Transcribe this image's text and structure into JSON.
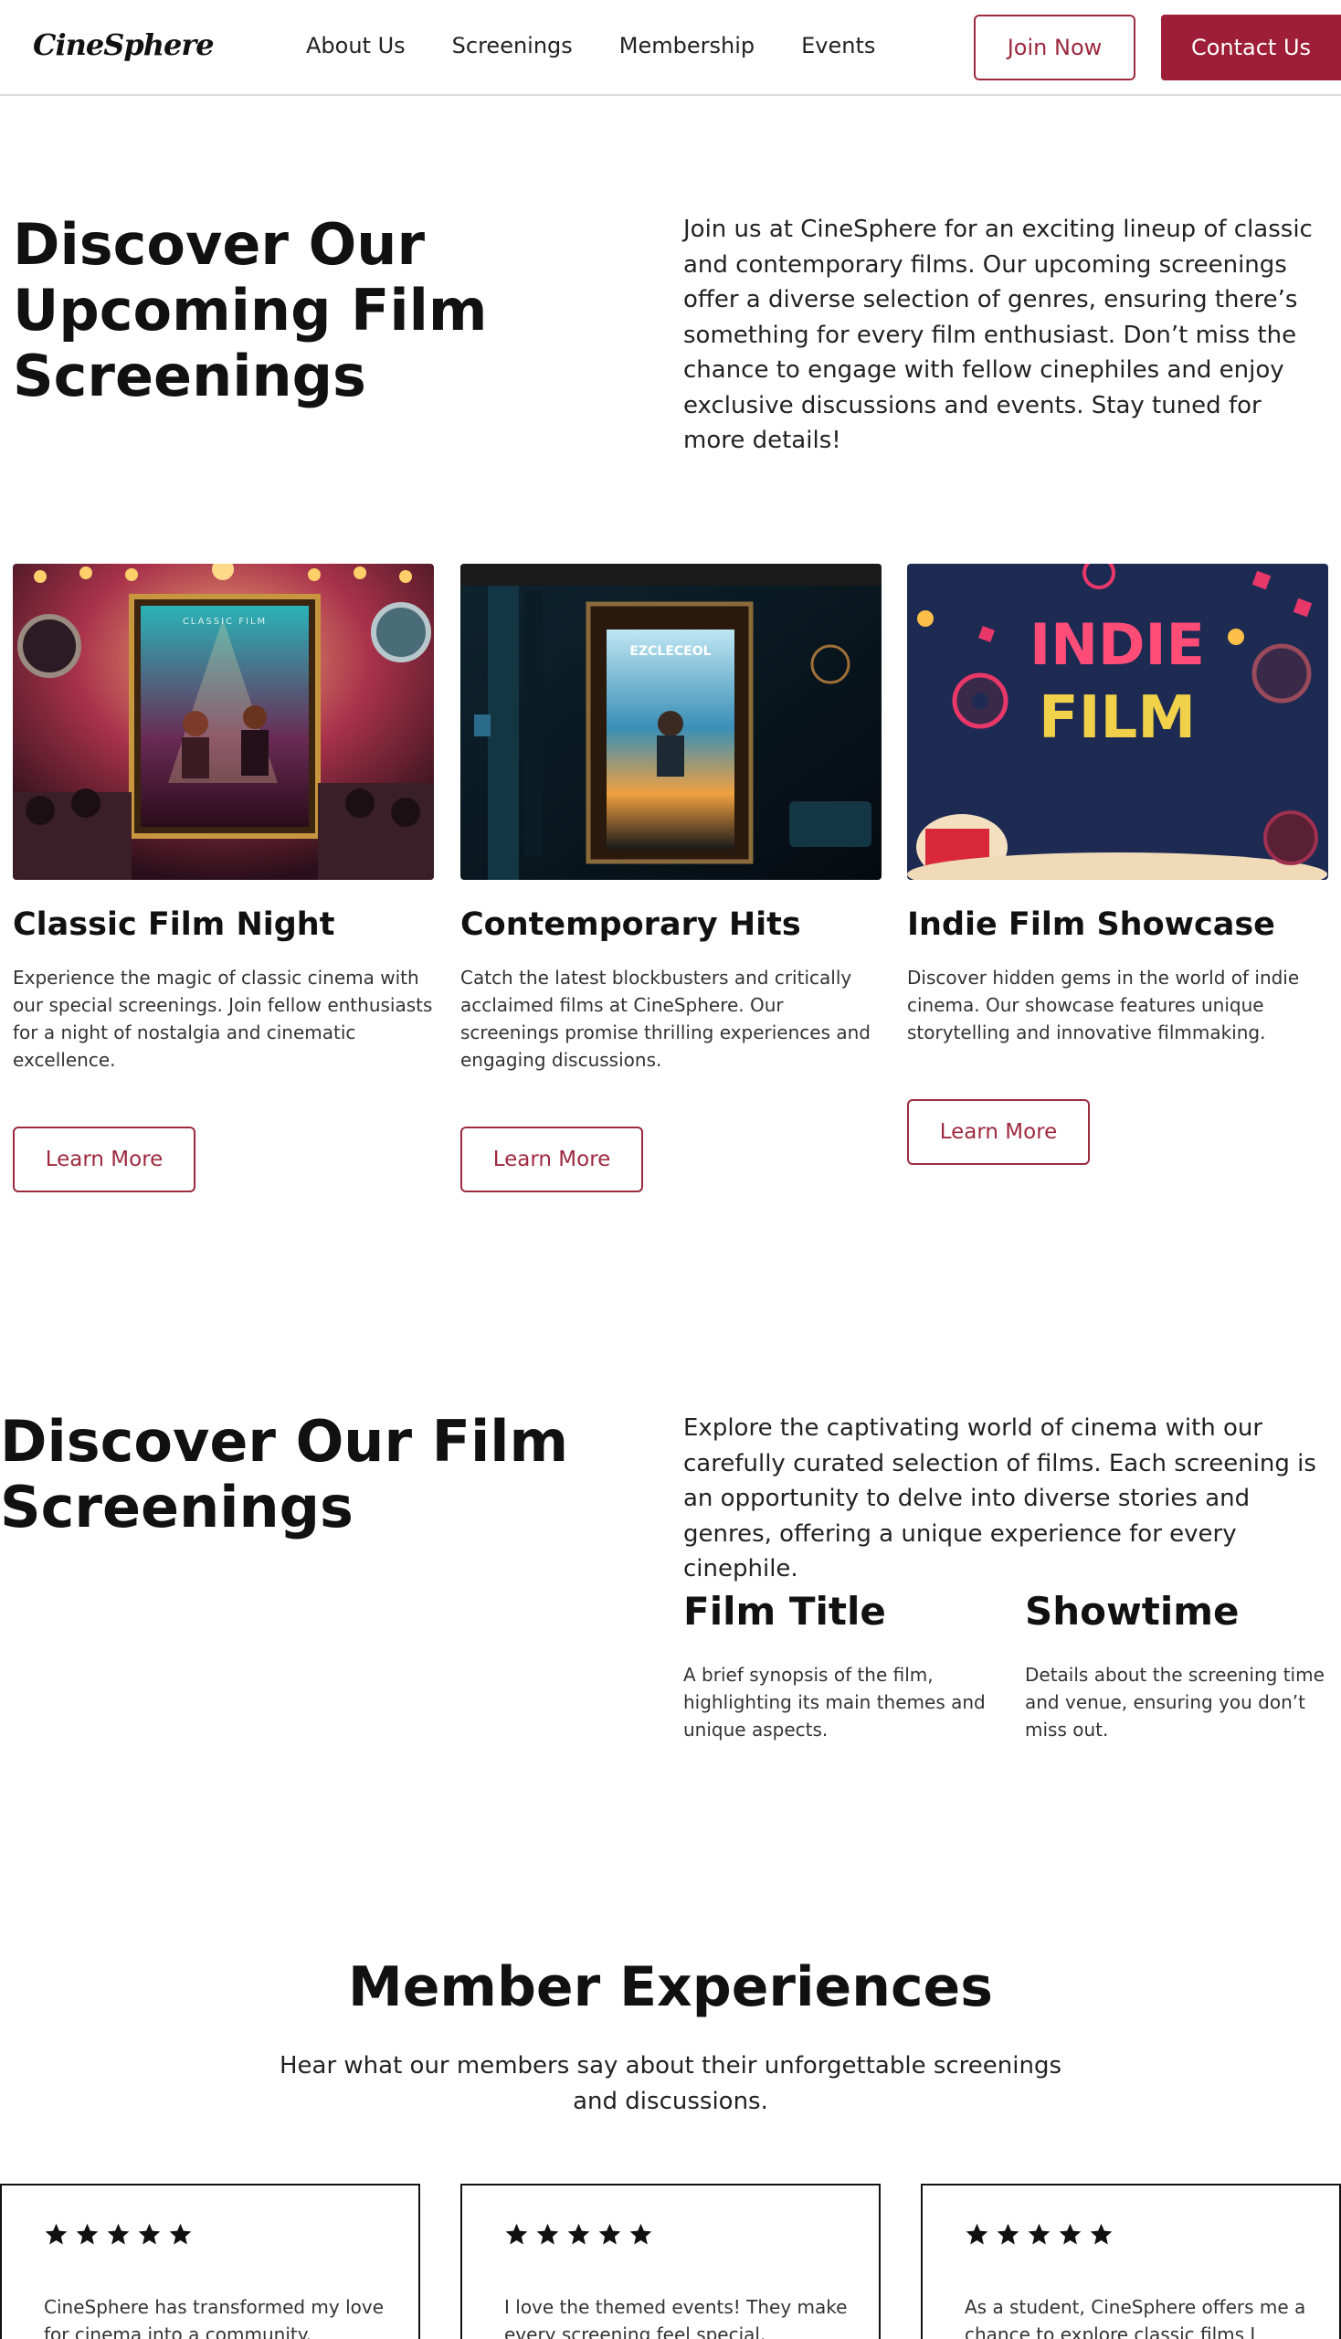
{
  "nav": {
    "logo": "CineSphere",
    "links": [
      "About Us",
      "Screenings",
      "Membership",
      "Events"
    ],
    "join_label": "Join Now",
    "contact_label": "Contact Us"
  },
  "hero": {
    "title": "Discover Our Upcoming Film Screenings",
    "description": "Join us at CineSphere for an exciting lineup of classic and contemporary films. Our upcoming screenings offer a diverse selection of genres, ensuring there’s something for every film enthusiast. Don’t miss the chance to engage with fellow cinephiles and enjoy exclusive discussions and events. Stay tuned for more details!"
  },
  "cards": [
    {
      "title": "Classic Film Night",
      "description": "Experience the magic of classic cinema with our special screenings. Join fellow enthusiasts for a night of nostalgia and cinematic excellence.",
      "button": "Learn More",
      "poster_text": "CLASSIC FILM"
    },
    {
      "title": "Contemporary Hits",
      "description": "Catch the latest blockbusters and critically acclaimed films at CineSphere. Our screenings promise thrilling experiences and engaging discussions.",
      "button": "Learn More",
      "poster_text": "EZCLECEOL"
    },
    {
      "title": "Indie Film Showcase",
      "description": "Discover hidden gems in the world of indie cinema. Our showcase features unique storytelling and innovative filmmaking.",
      "button": "Learn More",
      "poster_text": "INDIE FILM"
    }
  ],
  "section2": {
    "title": "Discover Our Film Screenings",
    "description": "Explore the captivating world of cinema with our carefully curated selection of films. Each screening is an opportunity to delve into diverse stories and genres, offering a unique experience for every cinephile.",
    "features": [
      {
        "title": "Film Title",
        "description": "A brief synopsis of the film, highlighting its main themes and unique aspects."
      },
      {
        "title": "Showtime",
        "description": "Details about the screening time and venue, ensuring you don’t miss out."
      }
    ]
  },
  "testimonials": {
    "title": "Member Experiences",
    "subtitle": "Hear what our members say about their unforgettable screenings and discussions.",
    "items": [
      {
        "rating": 5,
        "quote": "CineSphere has transformed my love for cinema into a community."
      },
      {
        "rating": 5,
        "quote": "I love the themed events! They make every screening feel special."
      },
      {
        "rating": 5,
        "quote": "As a student, CineSphere offers me a chance to explore classic films I"
      }
    ]
  },
  "colors": {
    "accent": "#9d1e36",
    "accent_outline": "#9d2a3e",
    "text": "#111111",
    "border": "#dcdcdc"
  }
}
